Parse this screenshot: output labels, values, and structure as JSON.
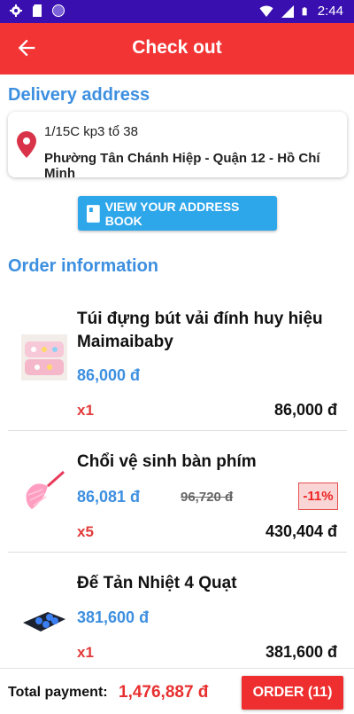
{
  "status_bar": {
    "time": "2:44",
    "left_icons": [
      "gear-icon",
      "sd-card-icon",
      "circle-icon"
    ],
    "right_icons": [
      "wifi-icon",
      "signal-icon",
      "battery-icon"
    ]
  },
  "app_bar": {
    "title": "Check out",
    "back_icon": "arrow-left-icon"
  },
  "delivery": {
    "title": "Delivery address",
    "line1": "1/15C kp3 tổ 38",
    "line2": "Phường Tân Chánh Hiệp -  Quận 12 - Hồ Chí Minh",
    "button": "VIEW YOUR ADDRESS BOOK"
  },
  "order": {
    "title": "Order information",
    "items": [
      {
        "name": "Túi đựng bút vải đính huy hiệu Maimaibaby",
        "price": "86,000 đ",
        "old_price": "",
        "discount": "",
        "qty": "x1",
        "total": "86,000 đ"
      },
      {
        "name": "Chổi vệ sinh bàn phím",
        "price": "86,081 đ",
        "old_price": "96,720 đ",
        "discount": "-11%",
        "qty": "x5",
        "total": "430,404 đ"
      },
      {
        "name": "Đế Tản Nhiệt 4 Quạt",
        "price": "381,600 đ",
        "old_price": "",
        "discount": "",
        "qty": "x1",
        "total": "381,600 đ"
      }
    ]
  },
  "footer": {
    "total_label": "Total payment:",
    "total_value": "1,476,887 đ",
    "order_button": "ORDER (11)"
  },
  "colors": {
    "status_bar": "#3a0fb0",
    "app_bar": "#f23434",
    "accent_blue": "#3d8fe0",
    "button_blue": "#2ea6ea",
    "red": "#e83030"
  }
}
